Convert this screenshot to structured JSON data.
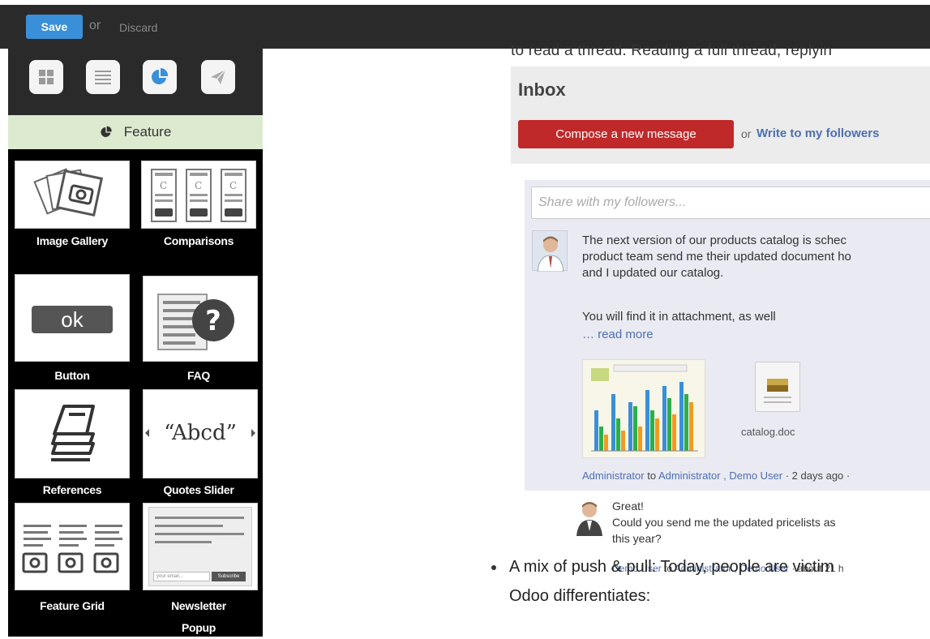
{
  "toolbar": {
    "save_label": "Save",
    "or_text": "or",
    "discard_label": "Discard",
    "accent": "#3a8fd9"
  },
  "sidebar": {
    "tabs": [
      {
        "icon": "grid-icon"
      },
      {
        "icon": "list-icon"
      },
      {
        "icon": "pie-chart-icon",
        "active": true
      },
      {
        "icon": "paper-plane-icon"
      }
    ],
    "section_title": "Feature",
    "snippets": [
      "Image Gallery",
      "Comparisons",
      "Button",
      "FAQ",
      "References",
      "Quotes Slider",
      "Feature Grid",
      "Newsletter\nPopup"
    ],
    "button_preview": "ok",
    "quote_preview": "“Abcd”",
    "newsletter_placeholder": "your email...",
    "newsletter_button": "Subscribe"
  },
  "content": {
    "clipped_line": "to read a thread. Reading a full thread, replyin",
    "inbox_title": "Inbox",
    "compose_label": "Compose a new message",
    "or_text": "or",
    "write_link": "Write to my followers",
    "share_placeholder": "Share with my followers...",
    "message": {
      "text": "The next version of our products catalog is schec\nproduct team send me their updated document ho\nand I updated our catalog.",
      "text2": "You will find it in attachment, as well",
      "read_more": "… read more",
      "attachment": "catalog.doc",
      "author": "Administrator",
      "to": "to",
      "recipients": "Administrator , Demo User",
      "time": "· 2 days ago ·"
    },
    "reply": {
      "text": "Great!\nCould you send me the updated pricelists as\nthis year?",
      "author": "Demo User",
      "to": "to",
      "recipients": "Administrator , Demo User",
      "time": "· about 21 h"
    },
    "bullet_text": "A mix of push & pull: Today, people are victim",
    "bullet_text2": "Odoo differentiates:"
  }
}
